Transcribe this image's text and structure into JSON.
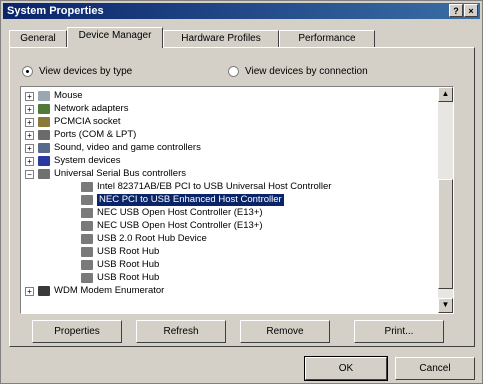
{
  "window": {
    "title": "System Properties",
    "help_button": "?",
    "close_button": "×"
  },
  "tabs": [
    {
      "label": "General"
    },
    {
      "label": "Device Manager"
    },
    {
      "label": "Hardware Profiles"
    },
    {
      "label": "Performance"
    }
  ],
  "view_options": {
    "by_type": "View devices by type",
    "by_connection": "View devices by connection",
    "selected": "by_type"
  },
  "tree": {
    "items": [
      {
        "label": "Mouse",
        "expander": "+"
      },
      {
        "label": "Network adapters",
        "expander": "+"
      },
      {
        "label": "PCMCIA socket",
        "expander": "+"
      },
      {
        "label": "Ports (COM & LPT)",
        "expander": "+"
      },
      {
        "label": "Sound, video and game controllers",
        "expander": "+"
      },
      {
        "label": "System devices",
        "expander": "+"
      },
      {
        "label": "Universal Serial Bus controllers",
        "expander": "−"
      },
      {
        "label": "Intel 82371AB/EB PCI to USB Universal Host Controller"
      },
      {
        "label": "NEC PCI to USB Enhanced Host Controller",
        "selected": true
      },
      {
        "label": "NEC USB Open Host Controller (E13+)"
      },
      {
        "label": "NEC USB Open Host Controller (E13+)"
      },
      {
        "label": "USB 2.0 Root Hub Device"
      },
      {
        "label": "USB Root Hub"
      },
      {
        "label": "USB Root Hub"
      },
      {
        "label": "USB Root Hub"
      },
      {
        "label": "WDM Modem Enumerator",
        "expander": "+"
      }
    ]
  },
  "actions": {
    "properties": "Properties",
    "refresh": "Refresh",
    "remove": "Remove",
    "print": "Print..."
  },
  "footer": {
    "ok": "OK",
    "cancel": "Cancel"
  }
}
